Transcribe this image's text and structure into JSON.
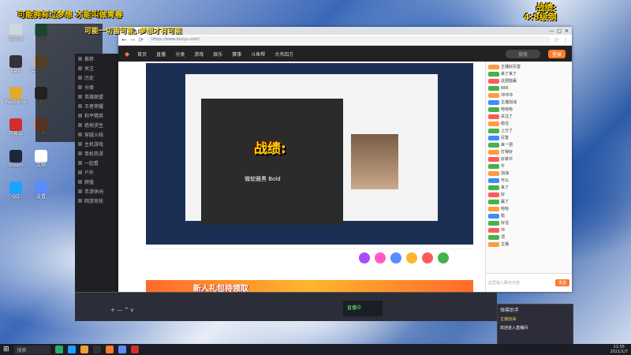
{
  "overlays": {
    "top_left": "可能拥有过梦想 才能叫做青春",
    "top_center": "可能一切皆可能, 梦想才有可能",
    "top_right_line1": "战绩:",
    "top_right_line2": "4:8级钢",
    "center": "战绩:",
    "font_label": "微软雅黑 Bold"
  },
  "desktop_icons": [
    {
      "label": "回收站",
      "color": "#cfd6e1"
    },
    {
      "label": "Epic",
      "color": "#333333"
    },
    {
      "label": "WeGame",
      "color": "#e0ab2e"
    },
    {
      "label": "网易云",
      "color": "#d12e2e"
    },
    {
      "label": "Steam",
      "color": "#1b2838"
    },
    {
      "label": "QQ",
      "color": "#1aa3ff"
    },
    {
      "label": "微信",
      "color": "#2aae67"
    },
    {
      "label": "Chrome",
      "color": "#e8a23a"
    },
    {
      "label": "OBS",
      "color": "#333333"
    },
    {
      "label": "斗鱼",
      "color": "#ff7a2d"
    },
    {
      "label": "文档",
      "color": "#ffffff"
    },
    {
      "label": "设置",
      "color": "#5b8cff"
    }
  ],
  "browser": {
    "tab_title": "斗鱼直播",
    "url": "https://www.douyu.com/",
    "nav_items": [
      "首页",
      "直播",
      "分类",
      "游戏",
      "娱乐",
      "赛事",
      "斗鱼帮",
      "大杀四方"
    ],
    "search_placeholder": "搜索",
    "login": "登录"
  },
  "chat": {
    "input_placeholder": "这里输入聊天内容",
    "send": "发送",
    "lines": [
      {
        "text": "主播好厉害",
        "color": "#ff9c3b"
      },
      {
        "text": "来了来了",
        "color": "#47b14a"
      },
      {
        "text": "这把能赢",
        "color": "#ff5a5a"
      },
      {
        "text": "666",
        "color": "#47b14a"
      },
      {
        "text": "冲冲冲",
        "color": "#ff9c3b"
      },
      {
        "text": "主播加油",
        "color": "#3b8cff"
      },
      {
        "text": "哈哈哈",
        "color": "#47b14a"
      },
      {
        "text": "关注了",
        "color": "#ff5a5a"
      },
      {
        "text": "稳住",
        "color": "#ff9c3b"
      },
      {
        "text": "上分了",
        "color": "#47b14a"
      },
      {
        "text": "厉害",
        "color": "#3b8cff"
      },
      {
        "text": "来一把",
        "color": "#47b14a"
      },
      {
        "text": "打得好",
        "color": "#ff9c3b"
      },
      {
        "text": "好家伙",
        "color": "#ff5a5a"
      },
      {
        "text": "牛",
        "color": "#47b14a"
      },
      {
        "text": "加油",
        "color": "#ff9c3b"
      },
      {
        "text": "可以",
        "color": "#3b8cff"
      },
      {
        "text": "来了",
        "color": "#47b14a"
      },
      {
        "text": "好",
        "color": "#ff5a5a"
      },
      {
        "text": "赢了",
        "color": "#47b14a"
      },
      {
        "text": "哈哈",
        "color": "#ff9c3b"
      },
      {
        "text": "稳",
        "color": "#3b8cff"
      },
      {
        "text": "好活",
        "color": "#47b14a"
      },
      {
        "text": "冲",
        "color": "#ff5a5a"
      },
      {
        "text": "顶",
        "color": "#47b14a"
      },
      {
        "text": "主播",
        "color": "#ff9c3b"
      }
    ]
  },
  "left_panel_rows": [
    "推荐",
    "关注",
    "历史",
    "分类",
    "英雄联盟",
    "王者荣耀",
    "和平精英",
    "绝地求生",
    "穿越火线",
    "主机游戏",
    "单机热游",
    "一起看",
    "户外",
    "颜值",
    "手游休闲",
    "网游竞技"
  ],
  "ad_text": "新人礼包待领取",
  "obs": {
    "add": "+ —  ^  v",
    "time_label": "直播中"
  },
  "mini_chat": {
    "title": "弹幕助手",
    "line1": "主播加油",
    "line2": "欢迎进入直播间"
  },
  "taskbar": {
    "search": "搜索",
    "clock_time": "21:55",
    "clock_date": "2021/1/7"
  },
  "colors": {
    "accent": "#ff7a2d",
    "overlay_yellow": "#ffd400"
  }
}
